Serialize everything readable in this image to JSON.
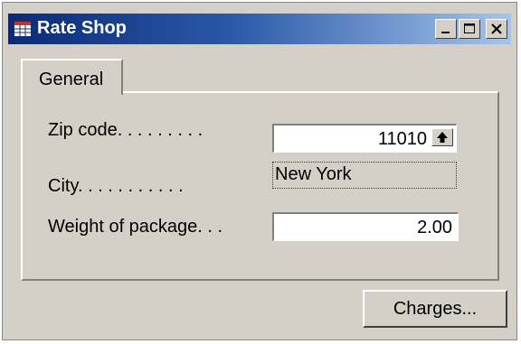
{
  "window": {
    "title": "Rate Shop",
    "controls": {
      "minimize": "minimize-icon",
      "maximize": "maximize-icon",
      "close": "close-icon"
    }
  },
  "tabs": [
    {
      "label": "General",
      "selected": true
    }
  ],
  "form": {
    "zip": {
      "label": "Zip code. . . . . . . . .",
      "value": "11010",
      "lookup_icon": "arrow-up-icon"
    },
    "city": {
      "label": "City. . . . . . . . . . .",
      "value": "New York"
    },
    "weight": {
      "label": "Weight of package. . .",
      "value": "2.00"
    }
  },
  "buttons": {
    "charges": "Charges..."
  }
}
